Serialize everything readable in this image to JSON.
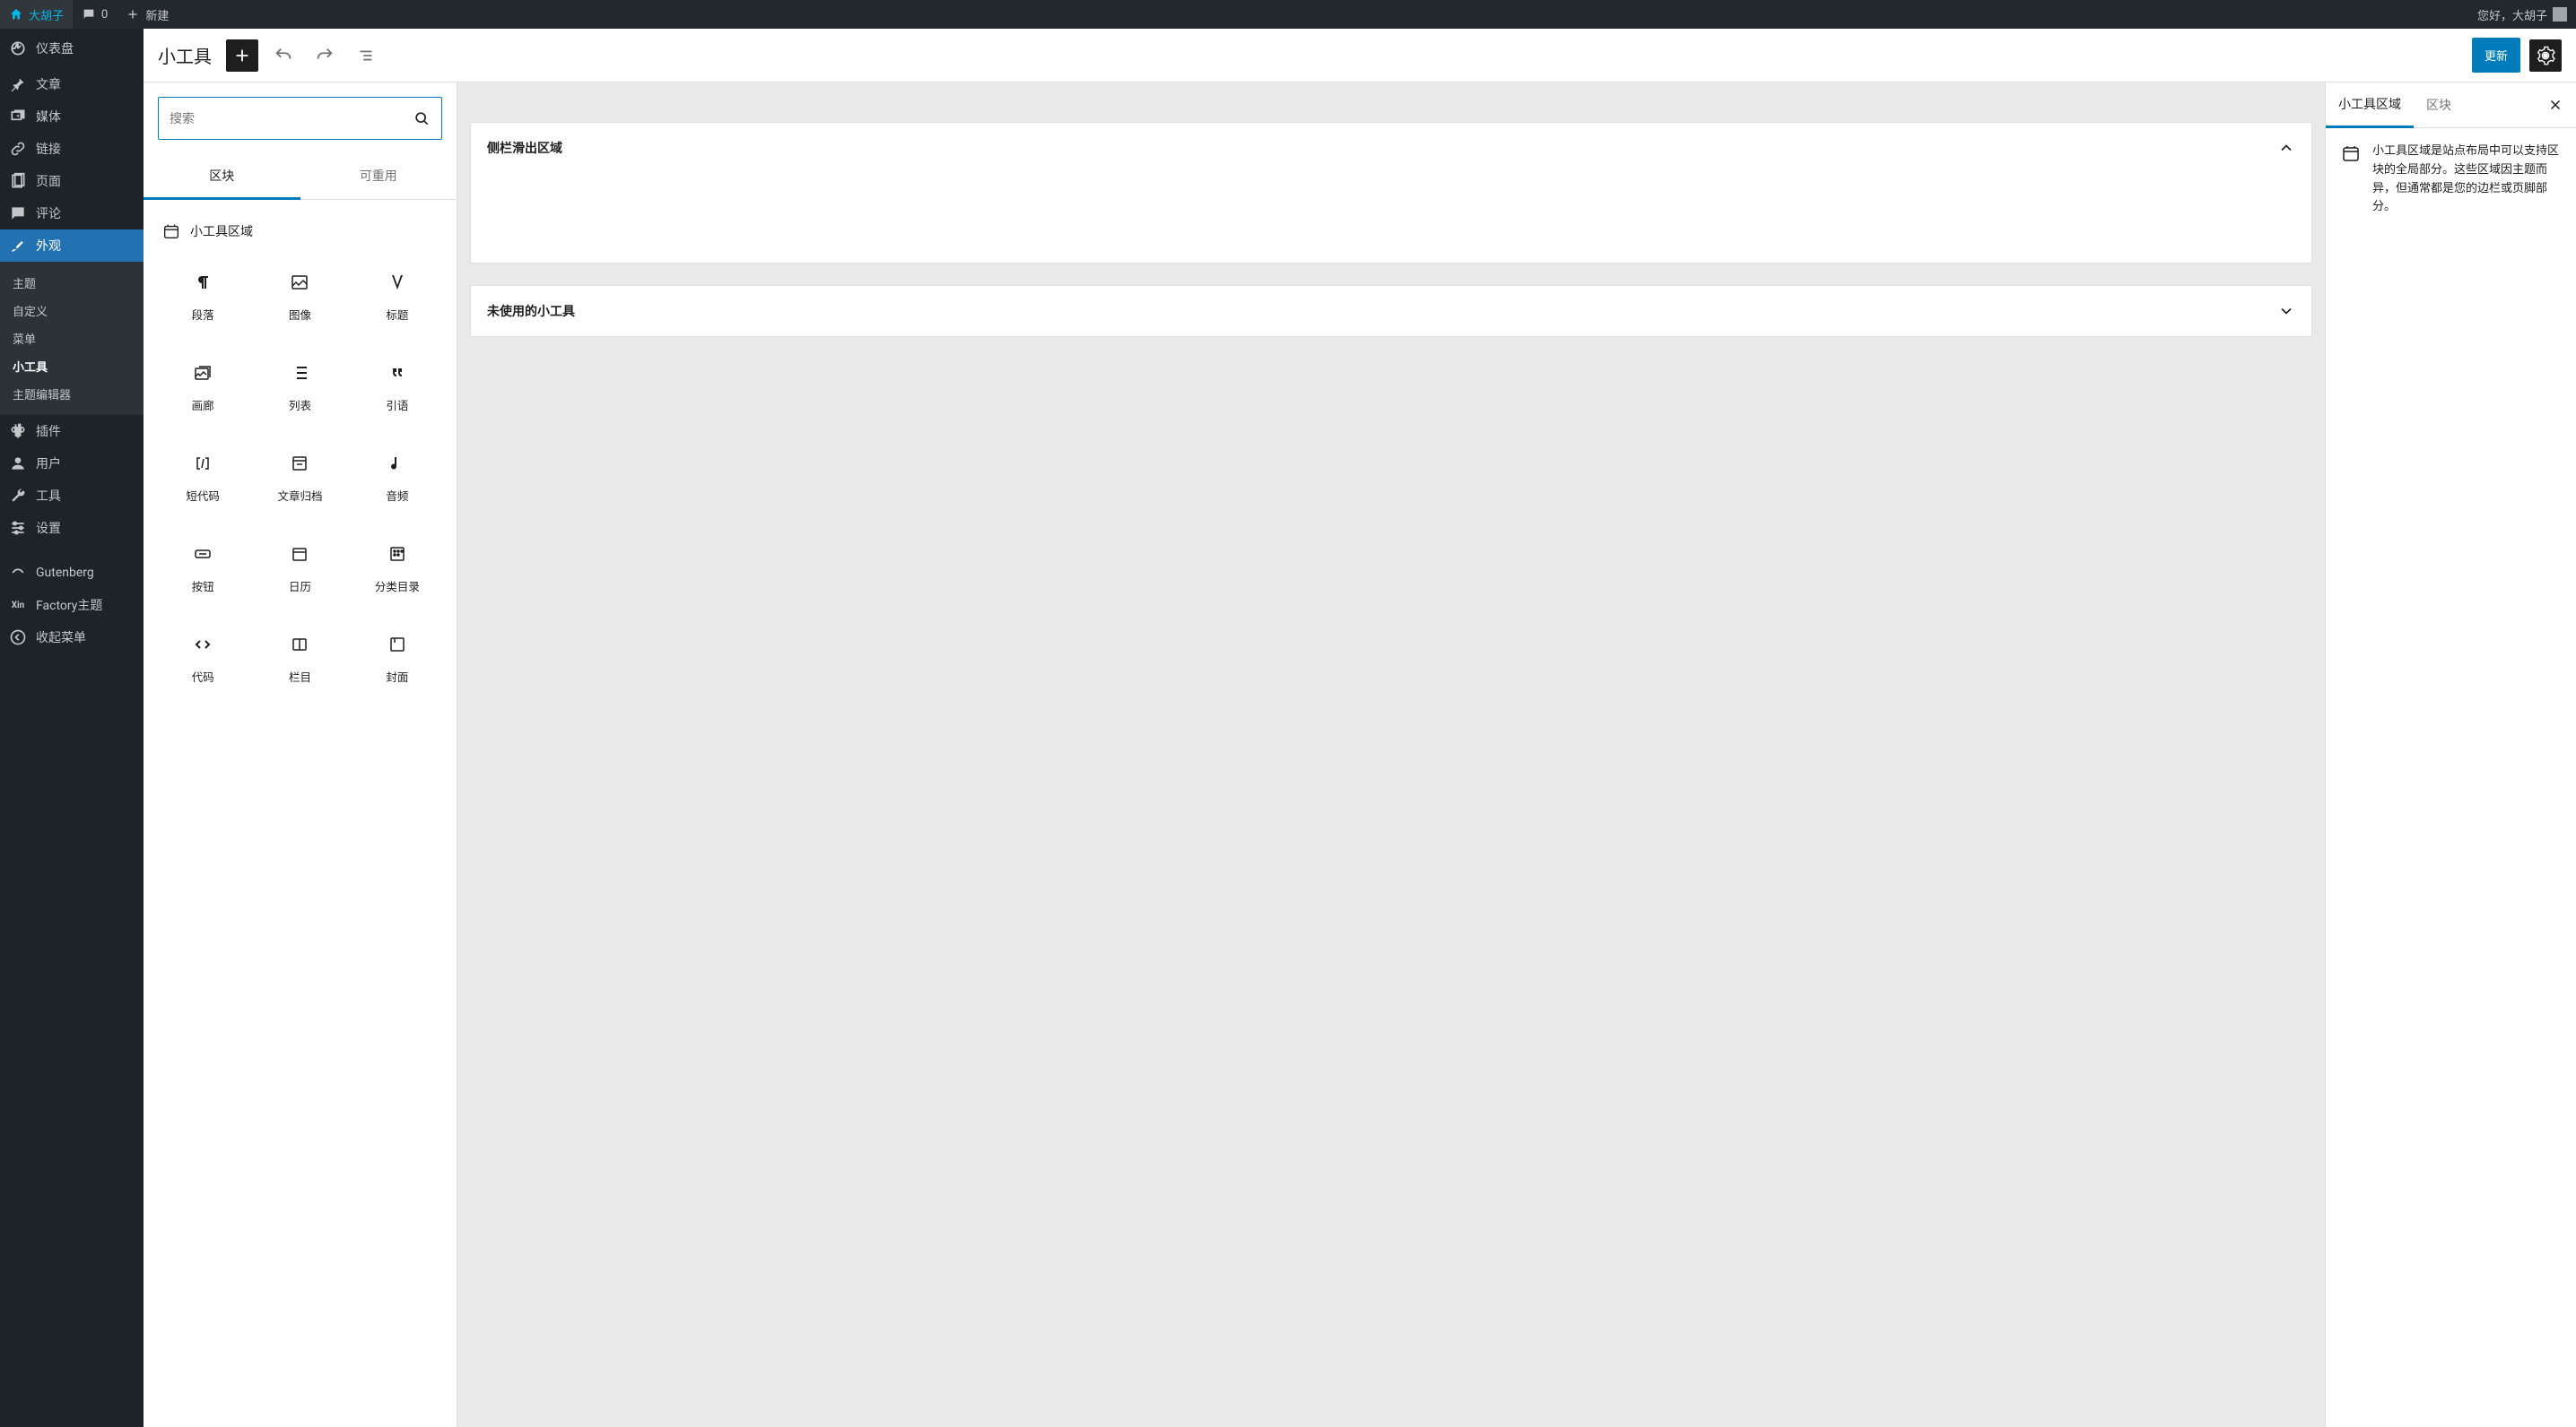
{
  "adminbar": {
    "site_name": "大胡子",
    "comments": "0",
    "new_label": "新建",
    "greeting": "您好，大胡子"
  },
  "sidebar": {
    "dashboard": "仪表盘",
    "posts": "文章",
    "media": "媒体",
    "links": "链接",
    "pages": "页面",
    "comments": "评论",
    "appearance": "外观",
    "sub_themes": "主题",
    "sub_customize": "自定义",
    "sub_menus": "菜单",
    "sub_widgets": "小工具",
    "sub_theme_editor": "主题编辑器",
    "plugins": "插件",
    "users": "用户",
    "tools": "工具",
    "settings": "设置",
    "gutenberg": "Gutenberg",
    "factory": "Factory主题",
    "collapse": "收起菜单"
  },
  "header": {
    "title": "小工具",
    "update": "更新"
  },
  "inserter": {
    "search_placeholder": "搜索",
    "tab_blocks": "区块",
    "tab_reusable": "可重用",
    "category": "小工具区域",
    "blocks": {
      "paragraph": "段落",
      "image": "图像",
      "heading": "标题",
      "gallery": "画廊",
      "list": "列表",
      "quote": "引语",
      "shortcode": "短代码",
      "archives": "文章归档",
      "audio": "音频",
      "button": "按钮",
      "calendar": "日历",
      "categories": "分类目录",
      "code": "代码",
      "columns": "栏目",
      "cover": "封面"
    }
  },
  "canvas": {
    "area1": "侧栏滑出区域",
    "area2": "未使用的小工具"
  },
  "settings": {
    "tab_area": "小工具区域",
    "tab_block": "区块",
    "description": "小工具区域是站点布局中可以支持区块的全局部分。这些区域因主题而异，但通常都是您的边栏或页脚部分。"
  }
}
